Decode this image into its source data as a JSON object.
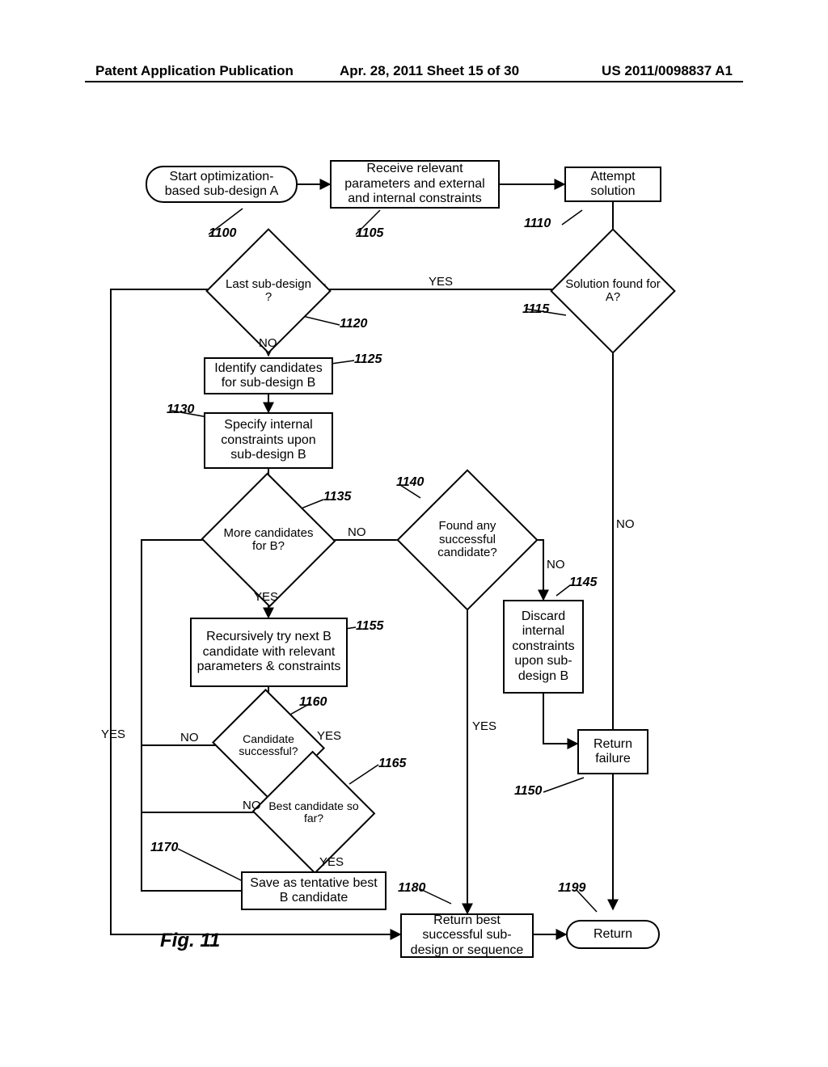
{
  "header": {
    "left": "Patent Application Publication",
    "mid": "Apr. 28, 2011  Sheet 15 of 30",
    "right": "US 2011/0098837 A1"
  },
  "figure_label": "Fig. 11",
  "nodes": {
    "n1100": "Start optimization-based sub-design A",
    "n1105": "Receive relevant parameters and external and internal constraints",
    "n1110": "Attempt solution",
    "n1115": "Solution found for A?",
    "n1120": "Last sub-design ?",
    "n1125": "Identify candidates for sub-design B",
    "n1130": "Specify internal constraints upon sub-design B",
    "n1135": "More candidates for B?",
    "n1140": "Found any successful candidate?",
    "n1145": "Discard internal constraints upon sub-design B",
    "n1150": "Return failure",
    "n1155": "Recursively try next B candidate with relevant parameters & constraints",
    "n1160": "Candidate successful?",
    "n1165": "Best candidate so far?",
    "n1170": "Save as tentative best B candidate",
    "n1180": "Return best successful sub-design or sequence",
    "n1199": "Return"
  },
  "refs": {
    "r1100": "1100",
    "r1105": "1105",
    "r1110": "1110",
    "r1115": "1115",
    "r1120": "1120",
    "r1125": "1125",
    "r1130": "1130",
    "r1135": "1135",
    "r1140": "1140",
    "r1145": "1145",
    "r1150": "1150",
    "r1155": "1155",
    "r1160": "1160",
    "r1165": "1165",
    "r1170": "1170",
    "r1180": "1180",
    "r1199": "1199"
  },
  "edge_labels": {
    "yes1": "YES",
    "no1": "NO",
    "no_1120": "NO",
    "no_1135": "NO",
    "yes_1135": "YES",
    "yes_1140": "YES",
    "no_1140": "NO",
    "no_1160": "NO",
    "yes_1160": "YES",
    "no_1165": "NO",
    "yes_1165": "YES",
    "yes_loop": "YES"
  }
}
